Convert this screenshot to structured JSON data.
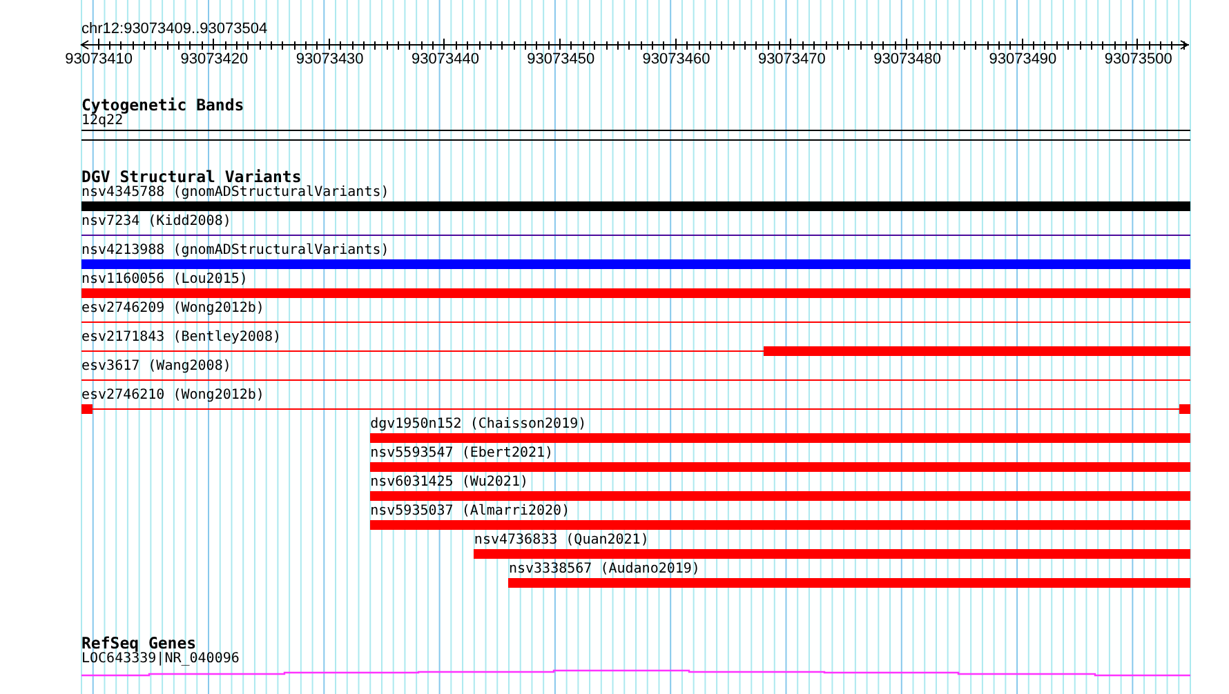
{
  "ruler": {
    "range_label": "chr12:93073409..93073504",
    "ticks": [
      "93073410",
      "93073420",
      "93073430",
      "93073440",
      "93073450",
      "93073460",
      "93073470",
      "93073480",
      "93073490",
      "93073500"
    ]
  },
  "tracks": [
    {
      "kind": "bands",
      "title": "Cytogenetic Bands",
      "features": [
        {
          "label": "12q22"
        }
      ]
    },
    {
      "kind": "variants",
      "title": "DGV Structural Variants",
      "features": [
        {
          "label": "nsv4345788 (gnomADStructuralVariants)",
          "color": "#000000",
          "kind": "bar"
        },
        {
          "label": "nsv7234 (Kidd2008)",
          "color": "#4b0a9c",
          "kind": "line"
        },
        {
          "label": "nsv4213988 (gnomADStructuralVariants)",
          "color": "#0000ff",
          "kind": "bar"
        },
        {
          "label": "nsv1160056 (Lou2015)",
          "color": "#ff0000",
          "kind": "bar"
        },
        {
          "label": "esv2746209 (Wong2012b)",
          "color": "#ff0000",
          "kind": "line"
        },
        {
          "label": "esv2171843 (Bentley2008)",
          "color": "#ff0000",
          "kind": "linebar",
          "level": 0.3854
        },
        {
          "label": "esv3617 (Wang2008)",
          "color": "#ff0000",
          "kind": "line"
        },
        {
          "label": "esv2746210 (Wong2012b)",
          "color": "#ff0000",
          "kind": "ends"
        },
        {
          "label": "dgv1950n152 (Chaisson2019)",
          "color": "#ff0000",
          "kind": "bar",
          "level": 0.7396
        },
        {
          "label": "nsv5593547 (Ebert2021)",
          "color": "#ff0000",
          "kind": "bar",
          "level": 0.7396
        },
        {
          "label": "nsv6031425 (Wu2021)",
          "color": "#ff0000",
          "kind": "bar",
          "level": 0.7396
        },
        {
          "label": "nsv5935037 (Almarri2020)",
          "color": "#ff0000",
          "kind": "bar",
          "level": 0.7396
        },
        {
          "label": "nsv4736833 (Quan2021)",
          "color": "#ff0000",
          "kind": "bar",
          "level": 0.6458
        },
        {
          "label": "nsv3338567 (Audano2019)",
          "color": "#ff0000",
          "kind": "bar",
          "level": 0.6146
        }
      ]
    },
    {
      "kind": "genes",
      "title": "RefSeq Genes",
      "features": [
        {
          "label": "LOC643339|NR_040096"
        }
      ]
    }
  ]
}
